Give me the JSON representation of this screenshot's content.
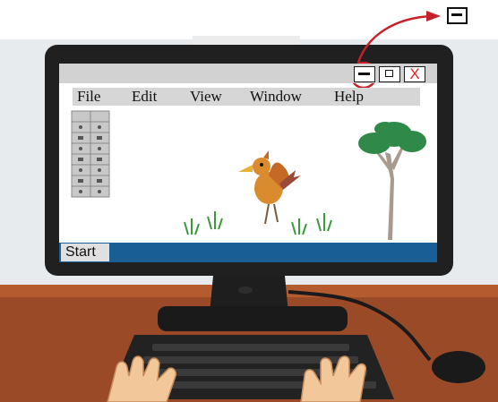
{
  "window": {
    "menu": [
      "File",
      "Edit",
      "View",
      "Window",
      "Help"
    ],
    "controls": {
      "minimize_icon": "minimize-icon",
      "maximize_icon": "maximize-icon",
      "close_label": "X"
    }
  },
  "taskbar": {
    "start_label": "Start"
  },
  "callout": {
    "icon": "minimize-icon",
    "highlight_color": "#c8202a"
  },
  "colors": {
    "taskbar": "#1a5e96",
    "titlebar": "#d2d2d2",
    "desk": "#9a4a27",
    "bird": "#d98b2e",
    "tree_leaves": "#2f8a4a"
  }
}
